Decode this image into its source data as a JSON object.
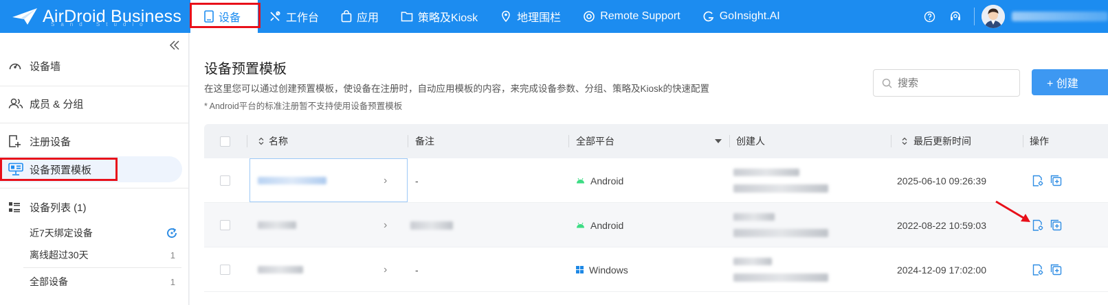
{
  "app": {
    "logo_text": "AirDroid Business",
    "logo_sub": "Sand Studio"
  },
  "nav": [
    {
      "label": "设备",
      "icon": "tablet-icon",
      "active": true
    },
    {
      "label": "工作台",
      "icon": "tools-icon"
    },
    {
      "label": "应用",
      "icon": "bag-icon"
    },
    {
      "label": "策略及Kiosk",
      "icon": "folder-icon"
    },
    {
      "label": "地理围栏",
      "icon": "map-pin-icon"
    },
    {
      "label": "Remote Support",
      "icon": "lifebuoy-icon"
    },
    {
      "label": "GoInsight.AI",
      "icon": "goinsight-icon"
    }
  ],
  "header_right": {
    "help_icon": "help-icon",
    "support_icon": "headset-icon"
  },
  "sidebar": {
    "items": [
      {
        "label": "设备墙",
        "icon": "dashboard-icon"
      },
      {
        "label": "成员 & 分组",
        "icon": "users-icon"
      },
      {
        "label": "注册设备",
        "icon": "register-device-icon"
      },
      {
        "label": "设备预置模板",
        "icon": "template-icon",
        "active": true
      },
      {
        "label": "设备列表 (1)",
        "icon": "list-icon"
      }
    ],
    "sub_items": [
      {
        "label": "近7天绑定设备",
        "count": ""
      },
      {
        "label": "离线超过30天",
        "count": "1"
      },
      {
        "label": "全部设备",
        "count": "1"
      }
    ]
  },
  "main": {
    "title": "设备预置模板",
    "description": "在这里您可以通过创建预置模板，使设备在注册时，自动应用模板的内容，来完成设备参数、分组、策略及Kiosk的快速配置",
    "note": "* Android平台的标准注册暂不支持使用设备预置模板",
    "search_placeholder": "搜索",
    "create_label": "+  创建"
  },
  "table": {
    "columns": {
      "name": "名称",
      "remark": "备注",
      "platform": "全部平台",
      "creator": "创建人",
      "updated": "最后更新时间",
      "actions": "操作"
    },
    "rows": [
      {
        "remark": "-",
        "platform": "Android",
        "platform_icon": "android-icon",
        "updated": "2025-06-10 09:26:39"
      },
      {
        "remark": "",
        "platform": "Android",
        "platform_icon": "android-icon",
        "updated": "2022-08-22 10:59:03"
      },
      {
        "remark": "-",
        "platform": "Windows",
        "platform_icon": "windows-icon",
        "updated": "2024-12-09 17:02:00"
      }
    ]
  },
  "colors": {
    "brand": "#1c8cf0",
    "highlight": "#e8101a",
    "android": "#3ddc84",
    "windows": "#1e88e5"
  }
}
